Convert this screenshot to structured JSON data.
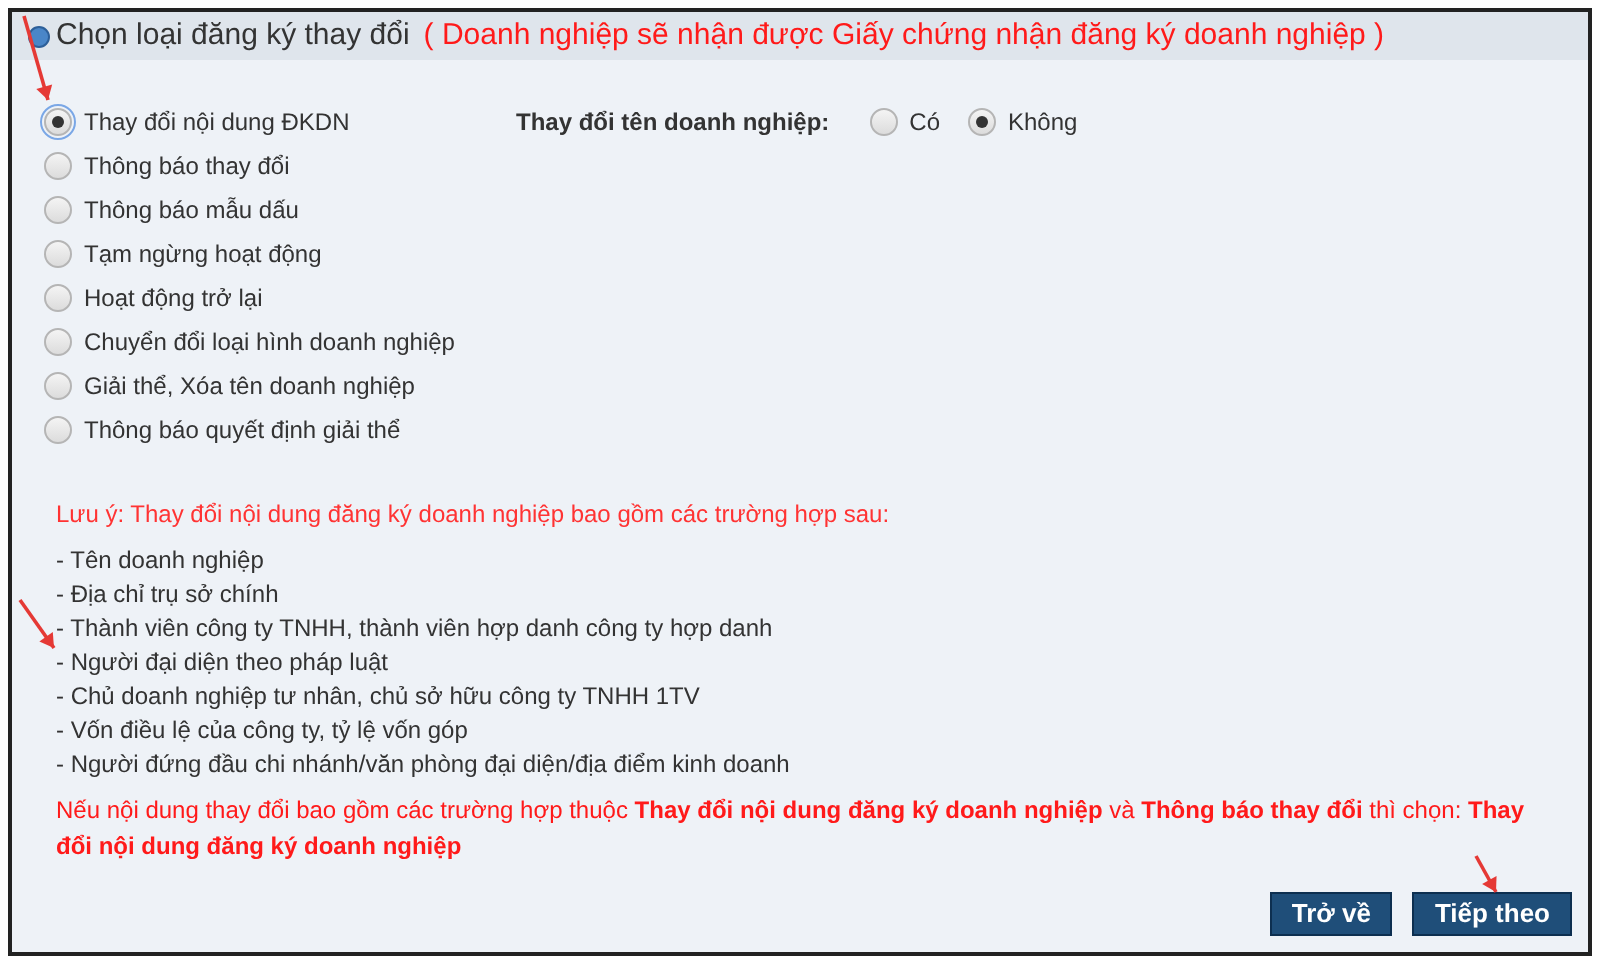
{
  "header": {
    "title": "Chọn loại đăng ký thay đổi",
    "note": "( Doanh nghiệp sẽ nhận được Giấy chứng nhận đăng ký doanh nghiệp )"
  },
  "options": [
    {
      "label": "Thay đổi nội dung ĐKDN",
      "selected": true
    },
    {
      "label": "Thông báo thay đổi",
      "selected": false
    },
    {
      "label": "Thông báo mẫu dấu",
      "selected": false
    },
    {
      "label": "Tạm ngừng hoạt động",
      "selected": false
    },
    {
      "label": "Hoạt động trở lại",
      "selected": false
    },
    {
      "label": "Chuyển đổi loại hình doanh nghiệp",
      "selected": false
    },
    {
      "label": "Giải thể, Xóa tên doanh nghiệp",
      "selected": false
    },
    {
      "label": "Thông báo quyết định giải thể",
      "selected": false
    }
  ],
  "name_change": {
    "label": "Thay đổi tên doanh nghiệp:",
    "choices": [
      {
        "label": "Có",
        "selected": false
      },
      {
        "label": "Không",
        "selected": true
      }
    ]
  },
  "notice": {
    "title": "Lưu ý: Thay đổi nội dung đăng ký doanh nghiệp bao gồm các trường hợp sau:",
    "items": [
      "- Tên doanh nghiệp",
      "- Địa chỉ trụ sở chính",
      "- Thành viên công ty TNHH, thành viên hợp danh công ty hợp danh",
      "- Người đại diện theo pháp luật",
      "- Chủ doanh nghiệp tư nhân, chủ sở hữu công ty TNHH 1TV",
      "- Vốn điều lệ của công ty, tỷ lệ vốn góp",
      "- Người đứng đầu chi nhánh/văn phòng đại diện/địa điểm kinh doanh"
    ],
    "footer": "Nếu nội dung thay đổi bao gồm các trường hợp thuộc **Thay đổi nội dung đăng ký doanh nghiệp** và **Thông báo thay đổi** thì chọn: **Thay đổi nội dung đăng ký doanh nghiệp**"
  },
  "buttons": [
    "Trở về",
    "Tiếp theo"
  ]
}
